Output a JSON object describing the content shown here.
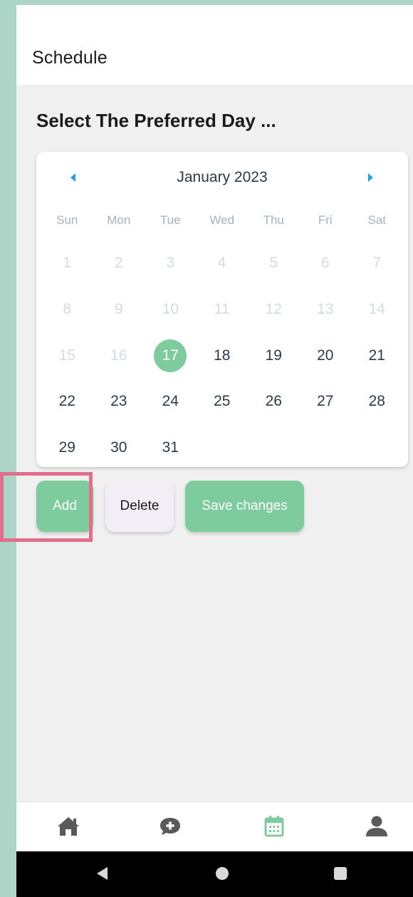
{
  "header": {
    "title": "Schedule"
  },
  "section": {
    "title": "Select The Preferred Day ..."
  },
  "calendar": {
    "month_label": "January 2023",
    "weekdays": [
      "Sun",
      "Mon",
      "Tue",
      "Wed",
      "Thu",
      "Fri",
      "Sat"
    ],
    "selected_day": "17",
    "weeks": [
      [
        {
          "d": "1",
          "s": "disabled"
        },
        {
          "d": "2",
          "s": "disabled"
        },
        {
          "d": "3",
          "s": "disabled"
        },
        {
          "d": "4",
          "s": "disabled"
        },
        {
          "d": "5",
          "s": "disabled"
        },
        {
          "d": "6",
          "s": "disabled"
        },
        {
          "d": "7",
          "s": "disabled"
        }
      ],
      [
        {
          "d": "8",
          "s": "disabled"
        },
        {
          "d": "9",
          "s": "disabled"
        },
        {
          "d": "10",
          "s": "disabled"
        },
        {
          "d": "11",
          "s": "disabled"
        },
        {
          "d": "12",
          "s": "disabled"
        },
        {
          "d": "13",
          "s": "disabled"
        },
        {
          "d": "14",
          "s": "disabled"
        }
      ],
      [
        {
          "d": "15",
          "s": "disabled"
        },
        {
          "d": "16",
          "s": "disabled"
        },
        {
          "d": "17",
          "s": "selected"
        },
        {
          "d": "18",
          "s": "active"
        },
        {
          "d": "19",
          "s": "active"
        },
        {
          "d": "20",
          "s": "active"
        },
        {
          "d": "21",
          "s": "active"
        }
      ],
      [
        {
          "d": "22",
          "s": "active"
        },
        {
          "d": "23",
          "s": "active"
        },
        {
          "d": "24",
          "s": "active"
        },
        {
          "d": "25",
          "s": "active"
        },
        {
          "d": "26",
          "s": "active"
        },
        {
          "d": "27",
          "s": "active"
        },
        {
          "d": "28",
          "s": "active"
        }
      ],
      [
        {
          "d": "29",
          "s": "active"
        },
        {
          "d": "30",
          "s": "active"
        },
        {
          "d": "31",
          "s": "active"
        },
        {
          "d": "",
          "s": "empty"
        },
        {
          "d": "",
          "s": "empty"
        },
        {
          "d": "",
          "s": "empty"
        },
        {
          "d": "",
          "s": "empty"
        }
      ]
    ],
    "prev_icon": "caret-left-icon",
    "next_icon": "caret-right-icon"
  },
  "actions": {
    "add_label": "Add",
    "delete_label": "Delete",
    "save_label": "Save changes"
  },
  "bottom_nav": {
    "items": [
      {
        "name": "home",
        "icon": "home-icon"
      },
      {
        "name": "chat",
        "icon": "chat-plus-icon"
      },
      {
        "name": "calendar",
        "icon": "calendar-icon",
        "active": true
      },
      {
        "name": "profile",
        "icon": "user-icon"
      }
    ]
  },
  "colors": {
    "accent": "#7ecb9e",
    "nav_arrow": "#1aa6e0",
    "highlight": "#df6f8d",
    "backdrop": "#acd5c8"
  }
}
